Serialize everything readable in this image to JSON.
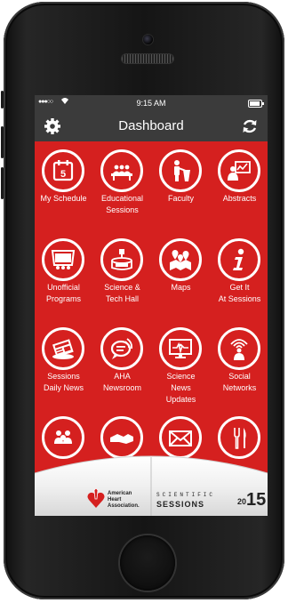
{
  "statusbar": {
    "signal": "●●●○○",
    "wifi_icon": "wifi-icon",
    "time": "9:15 AM",
    "battery_level": 0.9
  },
  "navbar": {
    "title": "Dashboard",
    "left_icon": "gear-icon",
    "right_icon": "refresh-icon"
  },
  "tiles": [
    {
      "label": "My Schedule",
      "icon": "calendar-icon"
    },
    {
      "label": "Educational\nSessions",
      "icon": "classroom-icon"
    },
    {
      "label": "Faculty",
      "icon": "lecturer-icon"
    },
    {
      "label": "Abstracts",
      "icon": "presentation-icon"
    },
    {
      "label": "Unofficial\nPrograms",
      "icon": "screen-icon"
    },
    {
      "label": "Science &\nTech Hall",
      "icon": "booth-icon"
    },
    {
      "label": "Maps",
      "icon": "map-pins-icon"
    },
    {
      "label": "Get It\nAt Sessions",
      "icon": "info-icon"
    },
    {
      "label": "Sessions\nDaily News",
      "icon": "newspaper-icon"
    },
    {
      "label": "AHA\nNewsroom",
      "icon": "speech-bubble-icon"
    },
    {
      "label": "Science\nNews\nUpdates",
      "icon": "monitor-heartbeat-icon"
    },
    {
      "label": "Social\nNetworks",
      "icon": "broadcast-person-icon"
    },
    {
      "label": "",
      "icon": "group-icon"
    },
    {
      "label": "",
      "icon": "handshake-icon"
    },
    {
      "label": "",
      "icon": "envelope-icon"
    },
    {
      "label": "",
      "icon": "dining-icon"
    }
  ],
  "footer": {
    "aha_logo_text": "American\nHeart\nAssociation.",
    "sessions_top": "SCIENTIFIC",
    "sessions_bottom": "SESSIONS",
    "year_small": "20",
    "year_big": "15"
  },
  "colors": {
    "screen_red": "#d5201f",
    "bar_gray": "#3b3b3b"
  }
}
